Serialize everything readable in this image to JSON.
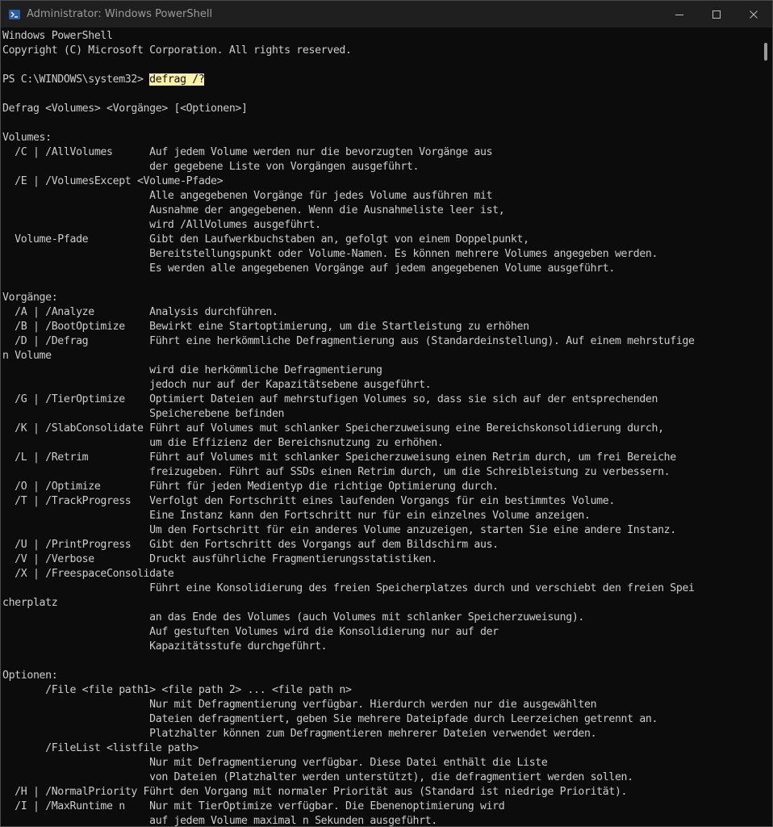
{
  "window": {
    "title": "Administrator: Windows PowerShell",
    "controls": {
      "minimize": "minimize-icon",
      "maximize": "maximize-icon",
      "close": "close-icon"
    }
  },
  "console": {
    "prompt": "PS C:\\WINDOWS\\system32> ",
    "command": "defrag /?",
    "lines": [
      "Windows PowerShell",
      "Copyright (C) Microsoft Corporation. All rights reserved.",
      "",
      "__PROMPT__",
      "",
      "Defrag <Volumes> <Vorgänge> [<Optionen>]",
      "",
      "Volumes:",
      "  /C | /AllVolumes      Auf jedem Volume werden nur die bevorzugten Vorgänge aus",
      "                        der gegebene Liste von Vorgängen ausgeführt.",
      "  /E | /VolumesExcept <Volume-Pfade>",
      "                        Alle angegebenen Vorgänge für jedes Volume ausführen mit",
      "                        Ausnahme der angegebenen. Wenn die Ausnahmeliste leer ist,",
      "                        wird /AllVolumes ausgeführt.",
      "  Volume-Pfade          Gibt den Laufwerkbuchstaben an, gefolgt von einem Doppelpunkt,",
      "                        Bereitstellungspunkt oder Volume-Namen. Es können mehrere Volumes angegeben werden.",
      "                        Es werden alle angegebenen Vorgänge auf jedem angegebenen Volume ausgeführt.",
      "",
      "Vorgänge:",
      "  /A | /Analyze         Analysis durchführen.",
      "  /B | /BootOptimize    Bewirkt eine Startoptimierung, um die Startleistung zu erhöhen",
      "  /D | /Defrag          Führt eine herkömmliche Defragmentierung aus (Standardeinstellung). Auf einem mehrstufige",
      "n Volume",
      "                        wird die herkömmliche Defragmentierung",
      "                        jedoch nur auf der Kapazitätsebene ausgeführt.",
      "  /G | /TierOptimize    Optimiert Dateien auf mehrstufigen Volumes so, dass sie sich auf der entsprechenden",
      "                        Speicherebene befinden",
      "  /K | /SlabConsolidate Führt auf Volumes mut schlanker Speicherzuweisung eine Bereichskonsolidierung durch,",
      "                        um die Effizienz der Bereichsnutzung zu erhöhen.",
      "  /L | /Retrim          Führt auf Volumes mit schlanker Speicherzuweisung einen Retrim durch, um frei Bereiche",
      "                        freizugeben. Führt auf SSDs einen Retrim durch, um die Schreibleistung zu verbessern.",
      "  /O | /Optimize        Führt für jeden Medientyp die richtige Optimierung durch.",
      "  /T | /TrackProgress   Verfolgt den Fortschritt eines laufenden Vorgangs für ein bestimmtes Volume.",
      "                        Eine Instanz kann den Fortschritt nur für ein einzelnes Volume anzeigen.",
      "                        Um den Fortschritt für ein anderes Volume anzuzeigen, starten Sie eine andere Instanz.",
      "  /U | /PrintProgress   Gibt den Fortschritt des Vorgangs auf dem Bildschirm aus.",
      "  /V | /Verbose         Druckt ausführliche Fragmentierungsstatistiken.",
      "  /X | /FreespaceConsolidate",
      "                        Führt eine Konsolidierung des freien Speicherplatzes durch und verschiebt den freien Spei",
      "cherplatz",
      "                        an das Ende des Volumes (auch Volumes mit schlanker Speicherzuweisung).",
      "                        Auf gestuften Volumes wird die Konsolidierung nur auf der",
      "                        Kapazitätsstufe durchgeführt.",
      "",
      "Optionen:",
      "       /File <file path1> <file path 2> ... <file path n>",
      "                        Nur mit Defragmentierung verfügbar. Hierdurch werden nur die ausgewählten",
      "                        Dateien defragmentiert, geben Sie mehrere Dateipfade durch Leerzeichen getrennt an.",
      "                        Platzhalter können zum Defragmentieren mehrerer Dateien verwendet werden.",
      "       /FileList <listfile path>",
      "                        Nur mit Defragmentierung verfügbar. Diese Datei enthält die Liste",
      "                        von Dateien (Platzhalter werden unterstützt), die defragmentiert werden sollen.",
      "  /H | /NormalPriority Führt den Vorgang mit normaler Priorität aus (Standard ist niedrige Priorität).",
      "  /I | /MaxRuntime n    Nur mit TierOptimize verfügbar. Die Ebenenoptimierung wird",
      "                        auf jedem Volume maximal n Sekunden ausgeführt."
    ]
  }
}
